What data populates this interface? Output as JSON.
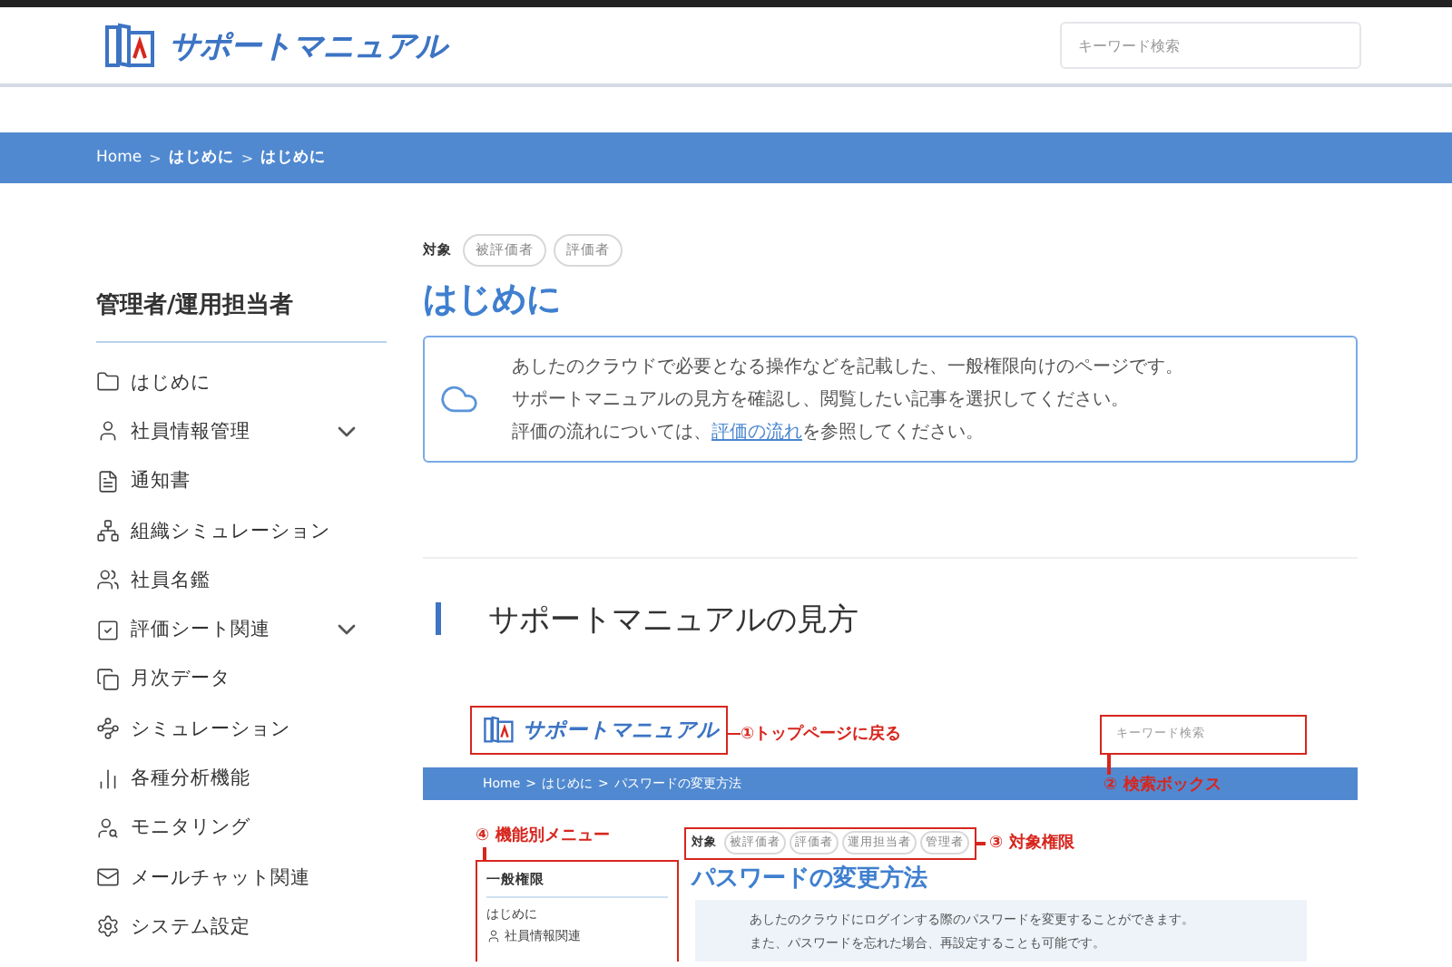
{
  "header": {
    "logo_text": "サポートマニュアル",
    "search": {
      "placeholder": "キーワード検索"
    }
  },
  "breadcrumb": {
    "separator": ">",
    "items": [
      "Home",
      "はじめに",
      "はじめに"
    ]
  },
  "sidebar": {
    "title": "管理者/運用担当者",
    "items": [
      {
        "label": "はじめに",
        "expandable": false
      },
      {
        "label": "社員情報管理",
        "expandable": true
      },
      {
        "label": "通知書",
        "expandable": false
      },
      {
        "label": "組織シミュレーション",
        "expandable": false
      },
      {
        "label": "社員名鑑",
        "expandable": false
      },
      {
        "label": "評価シート関連",
        "expandable": true
      },
      {
        "label": "月次データ",
        "expandable": false
      },
      {
        "label": "シミュレーション",
        "expandable": false
      },
      {
        "label": "各種分析機能",
        "expandable": false
      },
      {
        "label": "モニタリング",
        "expandable": false
      },
      {
        "label": "メールチャット関連",
        "expandable": false
      },
      {
        "label": "システム設定",
        "expandable": false
      }
    ]
  },
  "content": {
    "target_label": "対象",
    "targets": [
      "被評価者",
      "評価者"
    ],
    "title": "はじめに",
    "info": {
      "lines": [
        "あしたのクラウドで必要となる操作などを記載した、一般権限向けのページです。",
        "サポートマニュアルの見方を確認し、閲覧したい記事を選択してください。"
      ],
      "link_line": {
        "before": "評価の流れについては、",
        "link": "評価の流れ",
        "after": "を参照してください。"
      }
    },
    "section_heading": "サポートマニュアルの見方",
    "example": {
      "logo_text": "サポートマニュアル",
      "search_placeholder": "キーワード検索",
      "breadcrumb": [
        "Home",
        "はじめに",
        "パスワードの変更方法"
      ],
      "target_label": "対象",
      "targets": [
        "被評価者",
        "評価者",
        "運用担当者",
        "管理者"
      ],
      "title": "パスワードの変更方法",
      "sidebar_title": "一般権限",
      "sidebar_items": [
        "はじめに",
        "社員情報関連"
      ],
      "info_lines": [
        "あしたのクラウドにログインする際のパスワードを変更することができます。",
        "また、パスワードを忘れた場合、再設定することも可能です。"
      ],
      "annotations": [
        "①トップページに戻る",
        "② 検索ボックス",
        "③ 対象権限",
        "④ 機能別メニュー"
      ]
    }
  }
}
